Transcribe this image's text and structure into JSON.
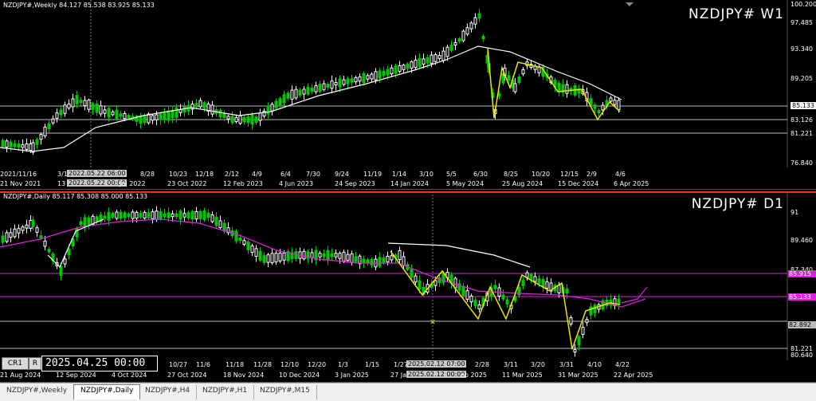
{
  "weekly": {
    "info": "NZDJPY#,Weekly  84.127 85.538 83.925 85.133",
    "title": "NZDJPY# W1",
    "scale": [
      "100.200",
      "97.485",
      "93.340",
      "89.205",
      "85.133",
      "83.126",
      "81.221",
      "76.840"
    ],
    "xticks": [
      "21 Nov 2021",
      "13",
      "23 Oct 2022",
      "12 Feb 2023",
      "4 Jun 2023",
      "24 Sep 2023",
      "14 Jan 2024",
      "5 May 2024",
      "25 Aug 2024",
      "15 Dec 2024",
      "6 Apr 2025"
    ],
    "xticks_top": [
      "2021/11/16",
      "3/1",
      "8/28",
      "10/23",
      "12/18",
      "2/12",
      "4/9",
      "6/4",
      "7/30",
      "9/24",
      "11/19",
      "1/14",
      "3/10",
      "5/5",
      "6/30",
      "8/25",
      "10/20",
      "12/15",
      "2/9",
      "4/6"
    ],
    "crosshair_top": "2022.05.22 06:00",
    "crosshair_bottom": "2022.05.22 00:00",
    "crosshair_tail": "Jul 2022"
  },
  "daily": {
    "info": "NZDJPY#,Daily  85.117 85.308 85.000 85.133",
    "title": "NZDJPY# D1",
    "scale": [
      "91",
      "89.460",
      "87.340",
      "85.915",
      "85.133",
      "82.892",
      "81.221",
      "80.640"
    ],
    "tags": {
      "magenta": "85.915",
      "magenta2": "85.133",
      "white": "82.892",
      "white2": "81.221"
    },
    "xticks": [
      "21 Aug 2024",
      "12 Sep 2024",
      "4 Oct 2024",
      "27 Oct 2024",
      "18 Nov 2024",
      "10 Dec 2024",
      "3 Jan 2025",
      "27 Ja",
      "eb 2025",
      "11 Mar 2025",
      "31 Mar 2025",
      "22 Apr 2025"
    ],
    "xticks_top": [
      "10/27",
      "11/6",
      "11/18",
      "11/28",
      "12/10",
      "12/20",
      "1/3",
      "1/15",
      "1/27",
      "2/28",
      "3/11",
      "3/20",
      "3/31",
      "4/10",
      "4/22"
    ],
    "crosshair_top": "2025.02.12 07:00",
    "crosshair_bottom": "2025.02.12 00:00",
    "cr_label": "CR1",
    "r_label": "R",
    "date_box": "2025.04.25 00:00"
  },
  "tabs": [
    "NZDJPY#,Weekly",
    "NZDJPY#,Daily",
    "NZDJPY#,H4",
    "NZDJPY#,H1",
    "NZDJPY#,M15"
  ],
  "colors": {
    "bull": "#00c800",
    "bear": "#ffffff",
    "ma_white": "#ffffff",
    "ma_magenta": "#e020e0",
    "zigzag": "#e8e800",
    "separator": "#ff2a2a"
  }
}
